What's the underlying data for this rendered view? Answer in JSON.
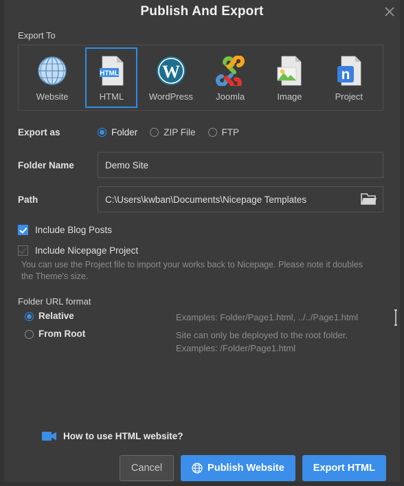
{
  "dialog": {
    "title": "Publish And Export",
    "close_icon": "close-icon"
  },
  "export_to": {
    "label": "Export To",
    "selected": "HTML",
    "targets": [
      {
        "label": "Website",
        "icon": "globe-icon",
        "selected": false
      },
      {
        "label": "HTML",
        "icon": "html-file-icon",
        "selected": true
      },
      {
        "label": "WordPress",
        "icon": "wordpress-icon",
        "selected": false
      },
      {
        "label": "Joomla",
        "icon": "joomla-icon",
        "selected": false
      },
      {
        "label": "Image",
        "icon": "image-file-icon",
        "selected": false
      },
      {
        "label": "Project",
        "icon": "nicepage-project-icon",
        "selected": false
      }
    ]
  },
  "export_as": {
    "label": "Export as",
    "options": [
      {
        "label": "Folder",
        "selected": true
      },
      {
        "label": "ZIP File",
        "selected": false
      },
      {
        "label": "FTP",
        "selected": false
      }
    ]
  },
  "folder_name": {
    "label": "Folder Name",
    "value": "Demo Site",
    "placeholder": "Folder Name"
  },
  "path": {
    "label": "Path",
    "value": "C:\\Users\\kwban\\Documents\\Nicepage Templates",
    "placeholder": "Path",
    "browse_icon": "folder-open-icon"
  },
  "options": {
    "include_blog_posts": {
      "label": "Include Blog Posts",
      "checked": true
    },
    "include_nicepage_project": {
      "label": "Include Nicepage Project",
      "checked": false,
      "hint": "You can use the Project file to import your works back to Nicepage. Please note it doubles the Theme's size."
    }
  },
  "folder_url_format": {
    "label": "Folder URL format",
    "options": [
      {
        "label": "Relative",
        "selected": true,
        "hint_line1": "Examples: Folder/Page1.html, ../../Page1.html",
        "hint_line2": ""
      },
      {
        "label": "From Root",
        "selected": false,
        "hint_line1": "Site can only be deployed to the root folder.",
        "hint_line2": "Examples: /Folder/Page1.html"
      }
    ]
  },
  "help": {
    "icon": "video-camera-icon",
    "label": "How to use HTML website?"
  },
  "buttons": {
    "cancel": "Cancel",
    "publish": "Publish Website",
    "publish_icon": "globe-icon",
    "export": "Export HTML"
  },
  "colors": {
    "accent": "#3b8eea",
    "selection_border": "#2e8de8",
    "dialog_bg": "#3b3b3b",
    "page_bg": "#333333"
  }
}
